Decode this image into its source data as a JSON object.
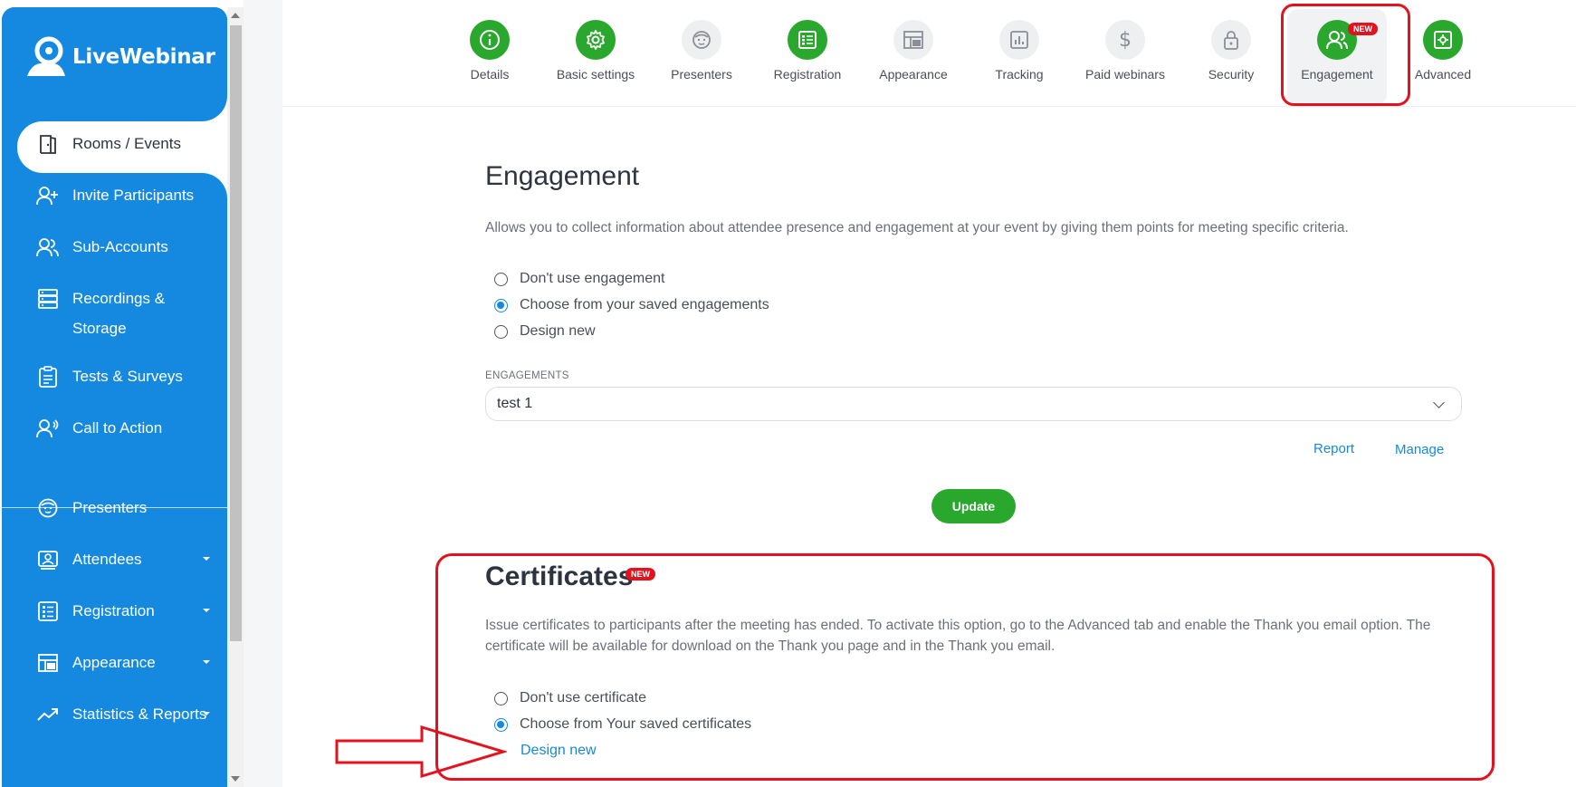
{
  "brand": {
    "name": "LiveWebinar"
  },
  "sidebar": {
    "items": [
      {
        "label": "Rooms / Events",
        "icon": "door-icon",
        "active": true
      },
      {
        "label": "Invite Participants",
        "icon": "user-plus-icon"
      },
      {
        "label": "Sub-Accounts",
        "icon": "users-icon"
      },
      {
        "label": "Recordings &",
        "label2": "Storage",
        "icon": "server-icon"
      },
      {
        "label": "Tests & Surveys",
        "icon": "clipboard-icon"
      },
      {
        "label": "Call to Action",
        "icon": "megaphone-user-icon"
      },
      {
        "label": "Presenters",
        "icon": "face-icon"
      },
      {
        "label": "Attendees",
        "icon": "attendee-icon",
        "dropdown": true
      },
      {
        "label": "Registration",
        "icon": "form-icon",
        "dropdown": true
      },
      {
        "label": "Appearance",
        "icon": "layout-icon",
        "dropdown": true
      },
      {
        "label": "Statistics & Reports",
        "icon": "trend-icon",
        "dropdown": true
      }
    ]
  },
  "tabs": [
    {
      "label": "Details",
      "icon": "info-icon",
      "style": "green"
    },
    {
      "label": "Basic settings",
      "icon": "gear-icon",
      "style": "green"
    },
    {
      "label": "Presenters",
      "icon": "face-icon",
      "style": "grey"
    },
    {
      "label": "Registration",
      "icon": "form-icon",
      "style": "green"
    },
    {
      "label": "Appearance",
      "icon": "layout-icon",
      "style": "grey"
    },
    {
      "label": "Tracking",
      "icon": "chart-icon",
      "style": "grey"
    },
    {
      "label": "Paid webinars",
      "icon": "dollar-icon",
      "style": "grey"
    },
    {
      "label": "Security",
      "icon": "lock-icon",
      "style": "grey"
    },
    {
      "label": "Engagement",
      "icon": "users-icon",
      "style": "green",
      "badge": "NEW",
      "selected": true
    },
    {
      "label": "Advanced",
      "icon": "advanced-icon",
      "style": "green"
    }
  ],
  "engagement": {
    "title": "Engagement",
    "description": "Allows you to collect information about attendee presence and engagement at your event by giving them points for meeting specific criteria.",
    "options": [
      {
        "label": "Don't use engagement",
        "checked": false
      },
      {
        "label": "Choose from your saved engagements",
        "checked": true
      },
      {
        "label": "Design new",
        "checked": false
      }
    ],
    "field_label": "ENGAGEMENTS",
    "selected_value": "test 1",
    "report_link": "Report",
    "manage_link": "Manage",
    "update_button": "Update"
  },
  "certificates": {
    "title": "Certificates",
    "badge": "NEW",
    "description_line1": "Issue certificates to participants after the meeting has ended. To activate this option, go to the Advanced tab and enable the Thank you email option. The",
    "description_line2": "certificate will be available for download on the Thank you page and in the Thank you email.",
    "options": [
      {
        "label": "Don't use certificate",
        "checked": false
      },
      {
        "label": "Choose from Your saved certificates",
        "checked": true
      }
    ],
    "design_new_link": "Design new"
  },
  "colors": {
    "sidebar_blue": "#1589e0",
    "accent_green": "#2aa72d",
    "annotation_red": "#e3121e",
    "link_blue": "#1589e0"
  }
}
